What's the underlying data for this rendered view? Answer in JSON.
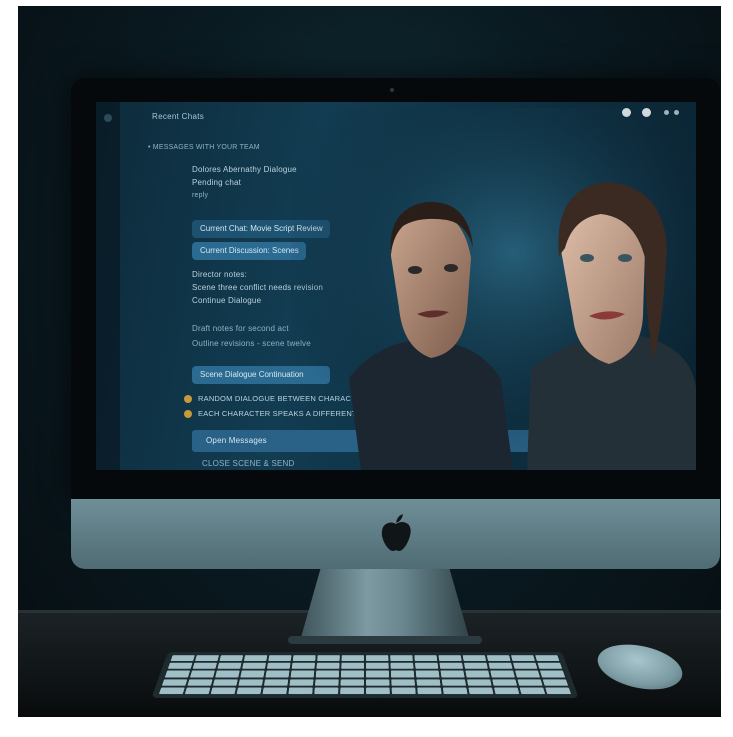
{
  "screen": {
    "title": "Recent Chats",
    "header_line": "• MESSAGES WITH YOUR TEAM",
    "block1": [
      "Dolores Abernathy Dialogue",
      "Pending chat",
      "reply"
    ],
    "pill1": "Current Chat: Movie Script Review",
    "pill2": "Current Discussion: Scenes",
    "block2": [
      "Director notes:",
      "Scene three conflict needs revision",
      "Continue Dialogue"
    ],
    "block3": [
      "Draft notes for second act",
      "Outline revisions - scene twelve"
    ],
    "pill3": "Scene Dialogue Continuation",
    "line_a": "RANDOM DIALOGUE BETWEEN CHARACTERS IN THE SCENE FOR THE SCRIPT...",
    "line_b": "EACH CHARACTER SPEAKS A DIFFERENT LINE FOR THE SCENE AS IT UNFOLDS",
    "pill4": "Open Messages",
    "footer_line": "CLOSE SCENE & SEND"
  },
  "colors": {
    "screen_accent": "#2b6a91",
    "bullet": "#c49a3a",
    "aluminum": "#6f8f98"
  },
  "icons": {
    "logo": "apple-logo",
    "window_controls": "window-control-dots"
  }
}
